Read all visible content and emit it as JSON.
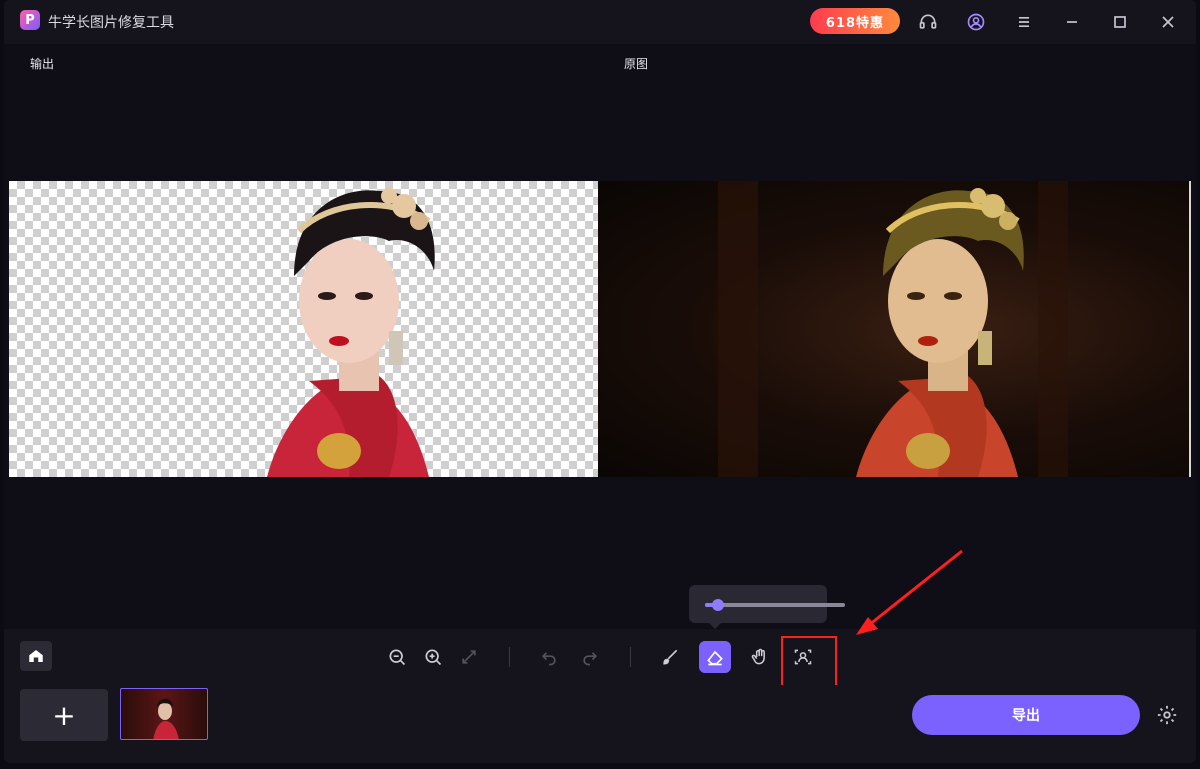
{
  "app": {
    "title": "牛学长图片修复工具",
    "logo_letter": "P"
  },
  "titlebar": {
    "promo_text": "618特惠"
  },
  "canvas": {
    "output_label": "输出",
    "original_label": "原图"
  },
  "slider": {
    "brush_size": 0.05
  },
  "bottom": {
    "export_label": "导出",
    "add_label": "+"
  },
  "colors": {
    "accent": "#7b62ff",
    "highlight": "#ff1f1f",
    "background": "#0f0d16"
  },
  "icons": [
    "home-icon",
    "zoom-out-icon",
    "zoom-in-icon",
    "fit-screen-icon",
    "undo-icon",
    "redo-icon",
    "brush-icon",
    "eraser-icon",
    "hand-icon",
    "portrait-select-icon",
    "headset-icon",
    "user-icon",
    "menu-icon",
    "minimize-icon",
    "maximize-icon",
    "close-icon",
    "settings-icon"
  ]
}
